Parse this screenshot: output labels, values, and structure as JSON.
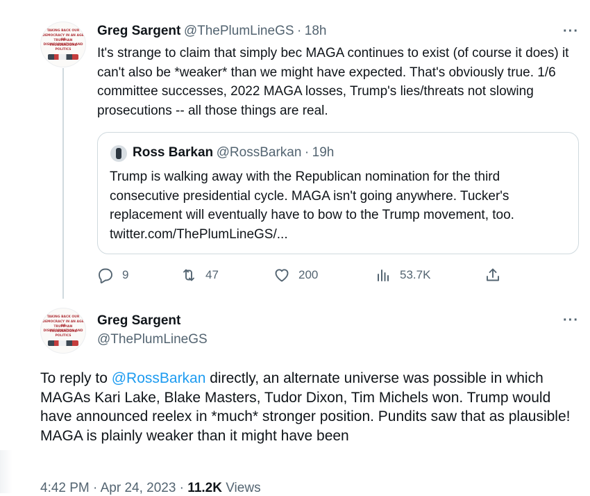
{
  "first_tweet": {
    "author_name": "Greg Sargent",
    "author_handle": "@ThePlumLineGS",
    "separator": "·",
    "time": "18h",
    "text": "It's strange to claim that simply bec MAGA continues to exist (of course it does) it can't also be *weaker* than we might have expected. That's obviously true. 1/6 committee successes, 2022 MAGA losses, Trump's lies/threats not slowing prosecutions -- all those things are real.",
    "more_label": "···",
    "quoted": {
      "author_name": "Ross Barkan",
      "author_handle": "@RossBarkan",
      "separator": "·",
      "time": "19h",
      "text": "Trump is walking away with the Republican nomination for the third consecutive presidential cycle. MAGA isn't going anywhere. Tucker's replacement will eventually have to bow to the Trump movement, too. twitter.com/ThePlumLineGS/..."
    },
    "actions": {
      "replies": "9",
      "retweets": "47",
      "likes": "200",
      "views": "53.7K"
    },
    "avatar_text": {
      "l1": "TAKING BACK OUR",
      "l2": "DEMOCRACY IN AN AGE OF",
      "l3": "TRUMPIAN DISINFORMATION AND",
      "l4": "THUNDERDOME POLITICS"
    }
  },
  "second_tweet": {
    "author_name": "Greg Sargent",
    "author_handle": "@ThePlumLineGS",
    "more_label": "···",
    "text_prefix": "To reply to ",
    "mention": "@RossBarkan",
    "text_suffix": " directly, an alternate universe was possible in which MAGAs Kari Lake, Blake Masters, Tudor Dixon, Tim Michels won. Trump would have announced reelex in *much* stronger position. Pundits saw that as plausible! MAGA is plainly weaker than it might have been",
    "timestamp": "4:42 PM · Apr 24, 2023",
    "dot": " · ",
    "view_count": "11.2K",
    "views_label": " Views"
  },
  "colors": {
    "text": "#0f1419",
    "muted": "#536471",
    "link": "#1d9bf0",
    "border": "#cfd9de"
  }
}
